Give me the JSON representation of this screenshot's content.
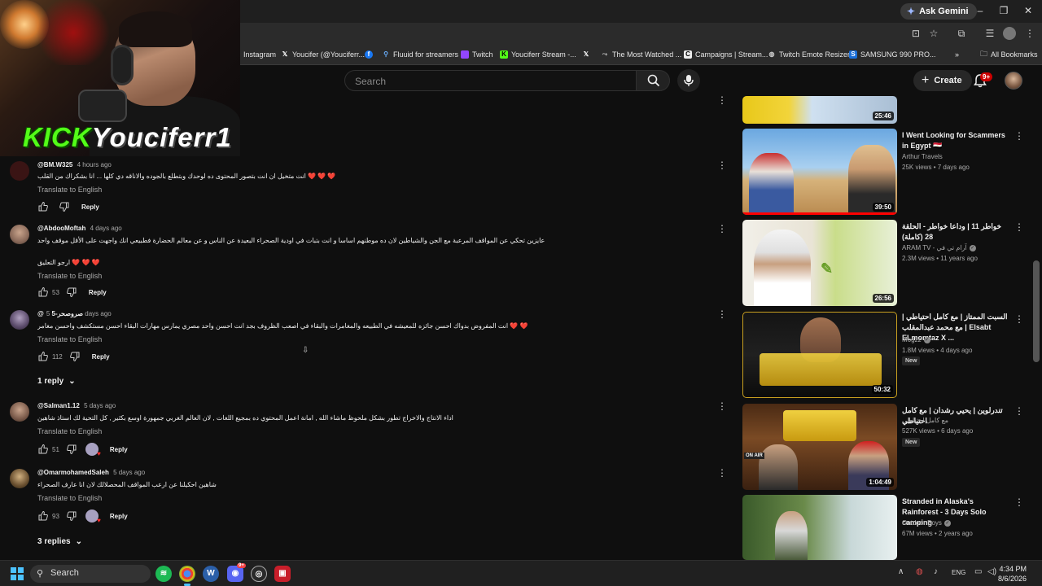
{
  "browser": {
    "gemini_label": "Ask Gemini",
    "bookmarks": [
      {
        "label": "Instagram",
        "icon": "instagram-icon"
      },
      {
        "label": "Youcifer (@Youciferr...",
        "icon": "x-icon"
      },
      {
        "label": "",
        "icon": "facebook-icon"
      },
      {
        "label": "Fluuid for streamers",
        "icon": "fluuid-icon"
      },
      {
        "label": "Twitch",
        "icon": "twitch-icon"
      },
      {
        "label": "Youciferr Stream -...",
        "icon": "kick-icon"
      },
      {
        "label": "",
        "icon": "x-icon"
      },
      {
        "label": "The Most Watched ...",
        "icon": "link-icon"
      },
      {
        "label": "Campaigns | Stream...",
        "icon": "campaign-icon"
      },
      {
        "label": "Twitch Emote Resizer",
        "icon": "globe-icon"
      },
      {
        "label": "SAMSUNG 990 PRO...",
        "icon": "samsung-icon"
      }
    ],
    "all_bookmarks": "All Bookmarks"
  },
  "webcam": {
    "overlay_prefix": "KICK",
    "overlay_username": "Youciferr1"
  },
  "youtube": {
    "search_placeholder": "Search",
    "create_label": "Create",
    "notification_count": "9+"
  },
  "comments": [
    {
      "author": "@BM.W325",
      "time": "4 hours ago",
      "lines": [
        "انت متخيل ان انت بتصور المحتوى ده لوحدك وبتطلع بالجوده والاناقه دي كلها ... انا بشكراك من القلب",
        "❤️ ❤️ ❤️"
      ],
      "translate": "Translate to English",
      "likes": "",
      "reply": "Reply",
      "creator_heart": false,
      "avatar_color": "#3a1414"
    },
    {
      "author": "@AbdooMoftah",
      "time": "4 days ago",
      "lines": [
        "عايزين تحكي عن المواقف المرعبة مع الجن والشياطين لان ده موطنهم اساسا و انت بتبات في اودية الصحراء البعيدة عن الناس و عن معالم الحضارة فطبيعي انك واجهت على الأقل موقف واحد",
        "",
        "ارجو التعليق ❤️ ❤️ ❤️"
      ],
      "translate": "Translate to English",
      "likes": "53",
      "reply": "Reply",
      "creator_heart": false,
      "avatar_color": "#8a6a5a"
    },
    {
      "author": "@صروصحر-5",
      "time": "5 days ago",
      "lines": [
        "انت المفروض بدواك احسن جائزه للمعيشه في الطبيعه والمغامرات والبقاء في اصعب الظروف بجد انت احسن واحد مصري يمارس مهارات البقاء احسن مستكشف واحسن مغامر ❤️ ❤️"
      ],
      "translate": "Translate to English",
      "likes": "112",
      "reply": "Reply",
      "creator_heart": false,
      "avatar_color": "#5a4a6a",
      "replies_label": "1 reply"
    },
    {
      "author": "@Salman1.12",
      "time": "5 days ago",
      "lines": [
        "اداء الانتاج والاخراج تطور بشكل ملحوظ ماشاء الله , امانة اعمل المحتوي ده بمجيع اللغات , لان العالم الغربي جمهورة اوسع بكثير , كل التحية لك استاذ شاهين"
      ],
      "translate": "Translate to English",
      "likes": "51",
      "reply": "Reply",
      "creator_heart": true,
      "avatar_color": "#7a5a4a"
    },
    {
      "author": "@OmarmohamedSaleh",
      "time": "5 days ago",
      "lines": [
        "شاهين احكيلنا عن ارعب المواقف المحصلالك لان انا عارف الصحراء"
      ],
      "translate": "Translate to English",
      "likes": "93",
      "reply": "Reply",
      "creator_heart": true,
      "avatar_color": "#6a5030",
      "replies_label": "3 replies"
    }
  ],
  "sidebar_videos": [
    {
      "title": "",
      "channel": "",
      "verified": false,
      "views": "",
      "age": "",
      "duration": "25:46",
      "new": false,
      "thumb": "linear-gradient(90deg,#e8c81a 0%,#f2d43a 30%,#cfe0f0 45%,#a9bed4 100%)"
    },
    {
      "title": "I Went Looking for Scammers in Egypt 🇪🇬",
      "channel": "Arthur Travels",
      "verified": false,
      "views": "25K views",
      "age": "7 days ago",
      "duration": "39:50",
      "new": false,
      "thumb": "linear-gradient(180deg,#6aa7e0 0%,#a9d0f0 45%,#d6b27a 60%,#b98a50 100%)"
    },
    {
      "title": "خواطر 11 | وداعا خواطر - الحلقة 28 (كاملة)",
      "channel": "ARAM TV - آرام تي في",
      "verified": true,
      "views": "2.3M views",
      "age": "11 years ago",
      "duration": "26:56",
      "new": false,
      "thumb": "linear-gradient(90deg,#f1efe8 0%,#e9e4d6 45%,#c9dd8a 60%,#e8f0d8 100%)"
    },
    {
      "title": "السبت الممتاز | مع كامل احتياطي | مع محمد عبدالمقلب | Elsabt ELmomtaz X ...",
      "channel": "Mogzz",
      "verified": true,
      "views": "1.8M views",
      "age": "4 days ago",
      "duration": "50:32",
      "new": true,
      "thumb": "linear-gradient(180deg,#141414 0%,#202020 50%,#0b0b0b 100%)"
    },
    {
      "title": "تندرلوين | يحيي رشدان | مع كامل احتياطي",
      "channel": "مع كامل احتياطي",
      "verified": false,
      "views": "527K views",
      "age": "6 days ago",
      "duration": "1:04:49",
      "new": true,
      "thumb": "linear-gradient(180deg,#4a2a14 0%,#7a4a24 40%,#3a2010 100%)"
    },
    {
      "title": "Stranded in Alaska's Rainforest - 3 Days Solo camping",
      "channel": "Outdoor Boys",
      "verified": true,
      "views": "67M views",
      "age": "2 years ago",
      "duration": "",
      "new": false,
      "thumb": "linear-gradient(90deg,#3a5a2a 0%,#6a8a4a 40%,#c8d8d8 70%,#e8f0f0 100%)"
    }
  ],
  "taskbar": {
    "search_label": "Search",
    "language": "ENG",
    "time": "4:34 PM",
    "date": "8/6/2026",
    "discord_badge": "9+"
  }
}
